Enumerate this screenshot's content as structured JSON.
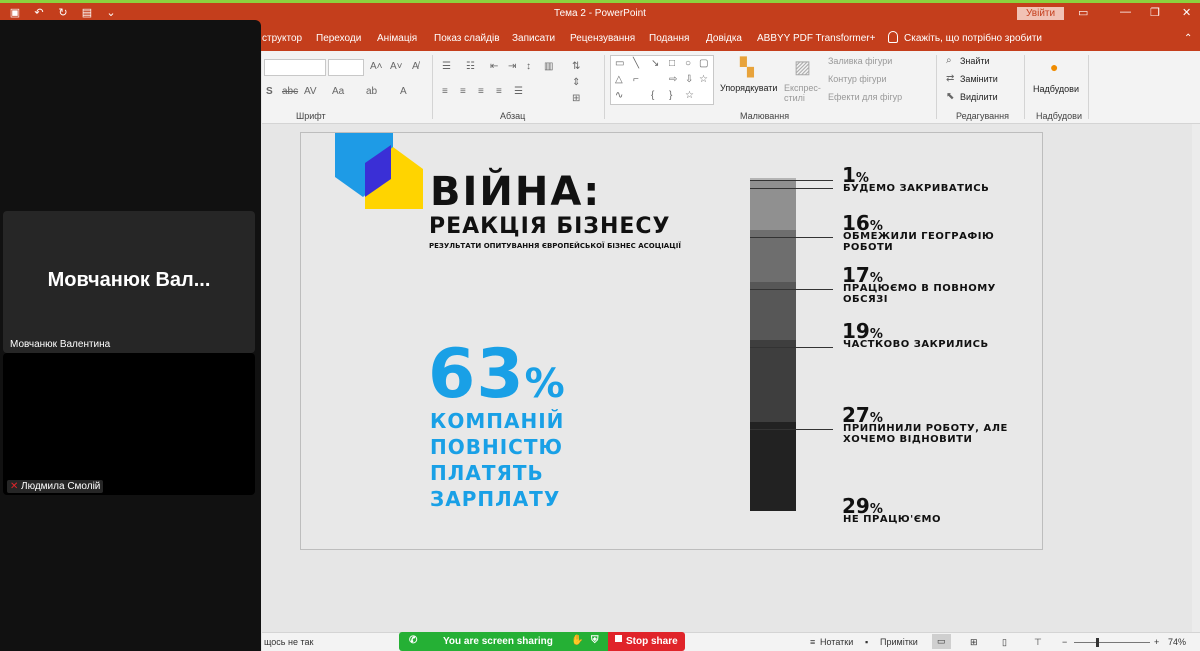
{
  "window": {
    "title": "Тема 2  -  PowerPoint",
    "signin_label": "Увійти"
  },
  "ribbon_tabs": [
    "структор",
    "Переходи",
    "Анімація",
    "Показ слайдів",
    "Записати",
    "Рецензування",
    "Подання",
    "Довідка",
    "ABBYY PDF Transformer+"
  ],
  "tell_me": "Скажіть, що потрібно зробити",
  "ribbon_groups": {
    "font": "Шрифт",
    "paragraph": "Абзац",
    "drawing": "Малювання",
    "editing": "Редагування",
    "addins": "Надбудови"
  },
  "ribbon_items": {
    "arrange": "Упорядкувати",
    "quick_styles": "Експрес-стилі",
    "shape_fill": "Заливка фігури",
    "shape_outline": "Контур фігури",
    "shape_effects": "Ефекти для фігур",
    "find": "Знайти",
    "replace": "Замінити",
    "select": "Виділити",
    "addins": "Надбудови"
  },
  "slide": {
    "headline": "ВІЙНА:",
    "subheadline": "РЕАКЦІЯ БІЗНЕСУ",
    "source": "РЕЗУЛЬТАТИ ОПИТУВАННЯ ЄВРОПЕЙСЬКОЇ БІЗНЕС АСОЦІАЦІЇ",
    "big_value": "63",
    "big_unit": "%",
    "big_caption": [
      "КОМПАНІЙ",
      "ПОВНІСТЮ",
      "ПЛАТЯТЬ",
      "ЗАРПЛАТУ"
    ],
    "stats": [
      {
        "value": "1",
        "unit": "%",
        "label": "БУДЕМО ЗАКРИВАТИСЬ",
        "share": 1,
        "color": "#b4b4b4"
      },
      {
        "value": "16",
        "unit": "%",
        "label": "ОБМЕЖИЛИ ГЕОГРАФІЮ РОБОТИ",
        "share": 16,
        "color": "#909090"
      },
      {
        "value": "17",
        "unit": "%",
        "label": "ПРАЦЮЄМО В ПОВНОМУ ОБСЯЗІ",
        "share": 17,
        "color": "#6e6e6e"
      },
      {
        "value": "19",
        "unit": "%",
        "label": "ЧАСТКОВО ЗАКРИЛИСЬ",
        "share": 19,
        "color": "#575757"
      },
      {
        "value": "27",
        "unit": "%",
        "label": "ПРИПИНИЛИ РОБОТУ, АЛЕ ХОЧЕМО ВІДНОВИТИ",
        "share": 27,
        "color": "#3e3e3e"
      },
      {
        "value": "29",
        "unit": "%",
        "label": "НЕ ПРАЦЮ'ЄМО",
        "share": 29,
        "color": "#222222"
      }
    ],
    "logo_colors": {
      "blue": "#1e9be6",
      "yellow": "#ffd400",
      "indigo": "#3a2fd6"
    }
  },
  "video": {
    "tile1_big": "Мовчанюк  Вал...",
    "tile1_name": "Мовчанюк Валентина",
    "tile2_name": "Людмила Смолій"
  },
  "statusbar": {
    "left_text": "щось не так",
    "sharing_text": "You are screen sharing",
    "stop_share": "Stop share",
    "notes": "Нотатки",
    "comments": "Примітки",
    "zoom": "74%"
  }
}
